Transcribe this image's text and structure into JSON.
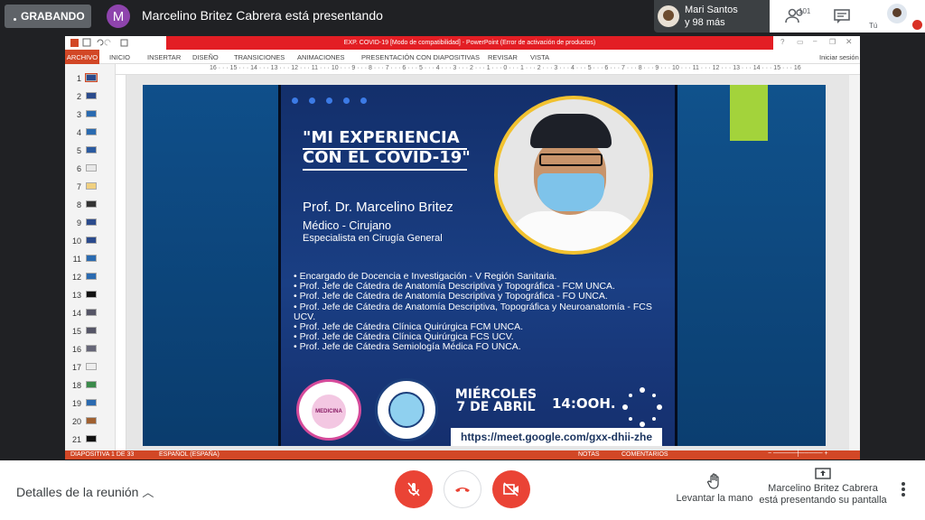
{
  "top": {
    "recording_label": "GRABANDO",
    "presenter_initial": "M",
    "presenting_text": "Marcelino Britez Cabrera está presentando",
    "participant_name": "Mari Santos",
    "participant_more": "y 98 más",
    "people_count": "101",
    "you_label": "Tú"
  },
  "ppt": {
    "title": "EXP. COVID-19 [Modo de compatibilidad] - PowerPoint (Error de activación de productos)",
    "tabs": [
      "ARCHIVO",
      "INICIO",
      "INSERTAR",
      "DISEÑO",
      "TRANSICIONES",
      "ANIMACIONES",
      "PRESENTACIÓN CON DIAPOSITIVAS",
      "REVISAR",
      "VISTA"
    ],
    "signin": "Iniciar sesión",
    "ruler": "16 · · · 15 · · · 14 · · · 13 · · · 12 · · · 11 · · · 10 · · · 9 · · · 8 · · · 7 · · · 6 · · · 5 · · · 4 · · · 3 · · · 2 · · · 1 · · · 0 · · · 1 · · · 2 · · · 3 · · · 4 · · · 5 · · · 6 · · · 7 · · · 8 · · · 9 · · · 10 · · · 11 · · · 12 · · · 13 · · · 14 · · · 15 · · · 16",
    "slide_numbers": [
      "1",
      "2",
      "3",
      "4",
      "5",
      "6",
      "7",
      "8",
      "9",
      "10",
      "11",
      "12",
      "13",
      "14",
      "15",
      "16",
      "17",
      "18",
      "19",
      "20",
      "21"
    ],
    "status_slide": "DIAPOSITIVA 1 DE 33",
    "status_lang": "ESPAÑOL (ESPAÑA)",
    "status_notes": "NOTAS",
    "status_comments": "COMENTARIOS"
  },
  "slide": {
    "title_line1": "\"MI EXPERIENCIA",
    "title_line2": "CON EL COVID-19\"",
    "prof": "Prof. Dr. Marcelino Britez",
    "role": "Médico - Cirujano",
    "spec": "Especialista en Cirugía General",
    "bullets": [
      "• Encargado de Docencia e Investigación - V Región Sanitaria.",
      "• Prof. Jefe de Cátedra de Anatomía Descriptiva y Topográfica - FCM UNCA.",
      "• Prof. Jefe de Cátedra de Anatomía Descriptiva y Topográfica - FO UNCA.",
      "• Prof. Jefe de Cátedra de Anatomía Descriptiva, Topográfica y Neuroanatomía - FCS UCV.",
      "• Prof. Jefe de Cátedra Clínica Quirúrgica FCM UNCA.",
      "• Prof. Jefe de Cátedra Clínica Quirúrgica FCS UCV.",
      "• Prof. Jefe de Cátedra Semiología Médica FO UNCA."
    ],
    "logo1_text": "MEDICINA",
    "date_line1": "MIÉRCOLES",
    "date_line2": "7 DE ABRIL",
    "time": "14:OOH.",
    "url": "https://meet.google.com/gxx-dhii-zhe"
  },
  "bottom": {
    "details": "Detalles de la reunión",
    "raise_hand": "Levantar la mano",
    "presenting_line1": "Marcelino Britez Cabrera",
    "presenting_line2": "está presentando su pantalla"
  },
  "colors": {
    "accent_red": "#ea4335",
    "ppt_orange": "#d24726",
    "title_red": "#e31e24",
    "slide_green": "#a3d33b",
    "photo_ring": "#f2c230"
  }
}
